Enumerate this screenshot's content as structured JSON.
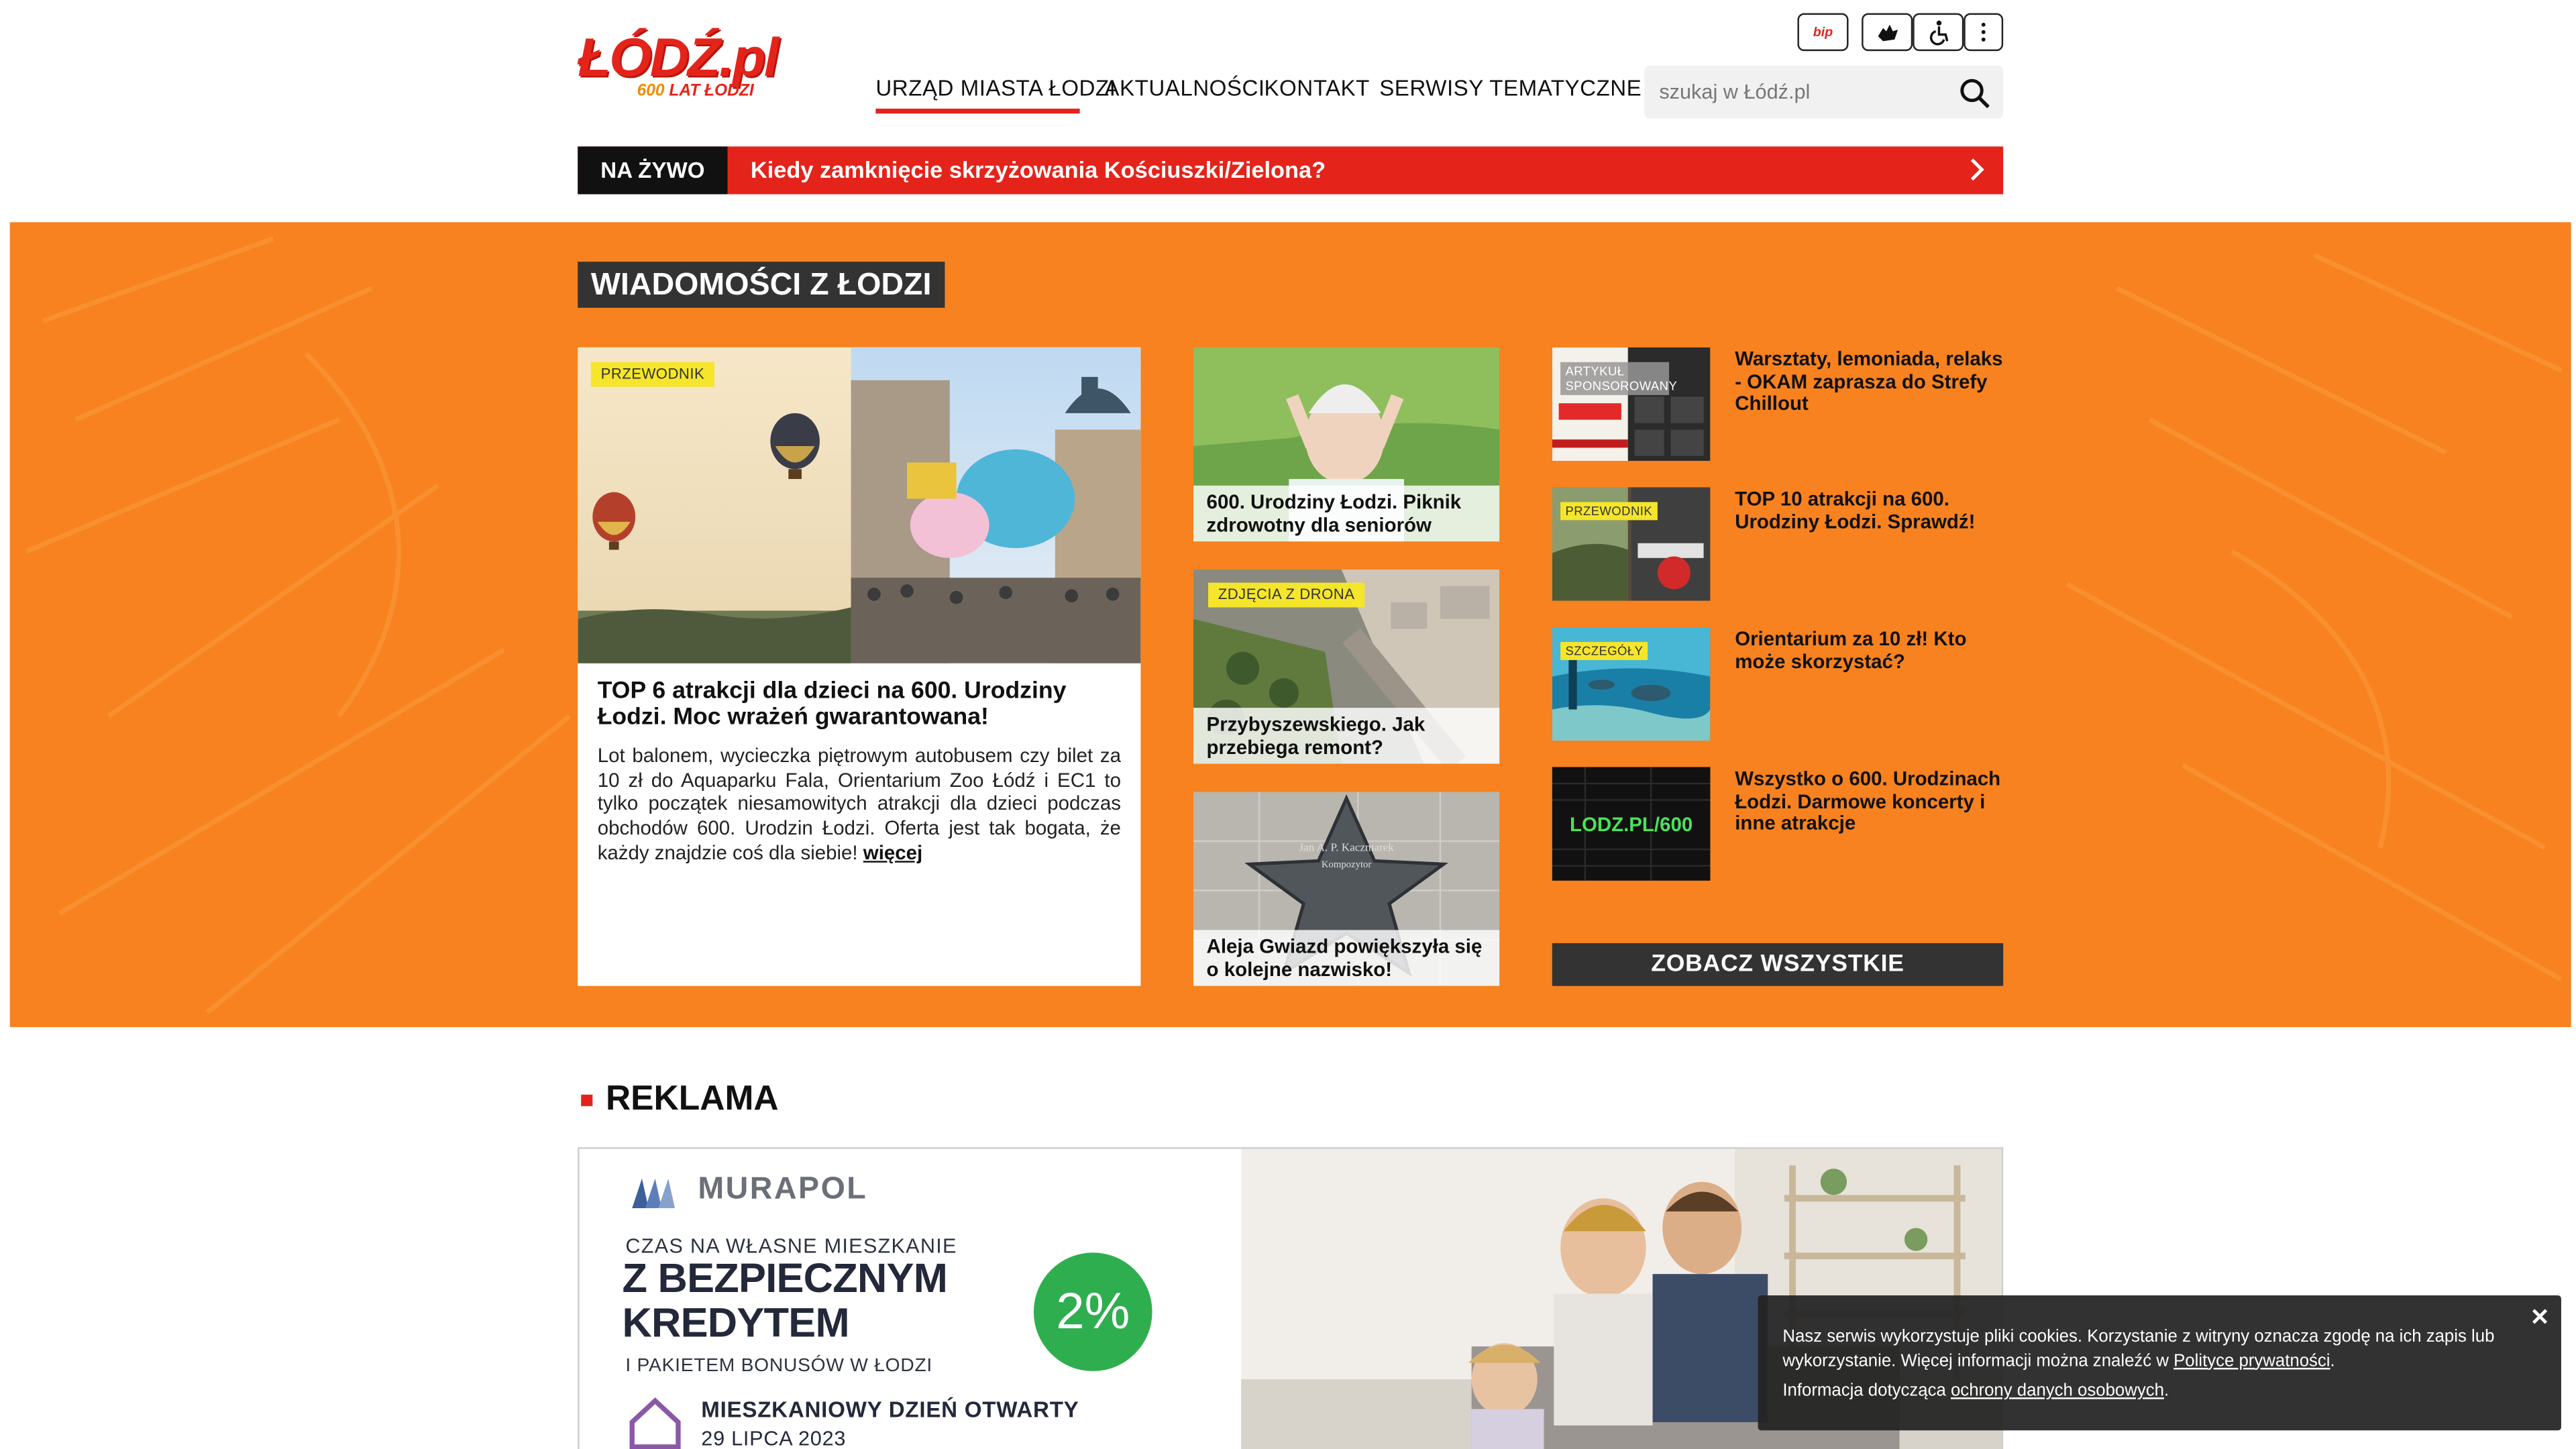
{
  "header": {
    "logo_main": "ŁÓDŹ.pl",
    "logo_sub_number": "600",
    "logo_sub_text": " LAT ŁODZI",
    "util_icons": [
      "bip-icon",
      "sign-language-icon",
      "wheelchair-icon",
      "more-vertical-icon"
    ],
    "bip_label": "bip",
    "nav": [
      {
        "label": "URZĄD MIASTA ŁODZI",
        "active": true
      },
      {
        "label": "AKTUALNOŚCI",
        "active": false
      },
      {
        "label": "KONTAKT",
        "active": false
      },
      {
        "label": "SERWISY TEMATYCZNE",
        "active": false,
        "dropdown": true
      }
    ],
    "search_placeholder": "szukaj w Łódź.pl"
  },
  "live": {
    "label": "NA ŻYWO",
    "text": "Kiedy zamknięcie skrzyżowania Kościuszki/Zielona?"
  },
  "news": {
    "section_title": "WIADOMOŚCI Z ŁODZI",
    "main": {
      "tag": "PRZEWODNIK",
      "title": "TOP 6 atrakcji dla dzieci na 600. Urodziny Łodzi. Moc wrażeń gwarantowana!",
      "lead": "Lot balonem, wycieczka piętrowym autobusem czy bilet za 10 zł do Aquaparku Fala, Orientarium Zoo Łódź i EC1 to tylko początek niesamowitych atrakcji dla dzieci podczas obchodów 600. Urodzin Łodzi. Oferta jest tak bogata, że każdy znajdzie coś dla siebie!",
      "more": "więcej"
    },
    "middle": [
      {
        "title": "600. Urodziny Łodzi. Piknik zdrowotny dla seniorów",
        "tag": ""
      },
      {
        "title": "Przybyszewskiego. Jak przebiega remont?",
        "tag": "ZDJĘCIA Z DRONA"
      },
      {
        "title": "Aleja Gwiazd powiększyła się o kolejne nazwisko!",
        "tag": "",
        "star_name": "Jan A. P. Kaczmarek",
        "star_role": "Kompozytor"
      }
    ],
    "side": [
      {
        "title": "Warsztaty, lemoniada, relaks - OKAM zaprasza do Strefy Chillout",
        "tag": "ARTYKUŁ SPONSOROWANY"
      },
      {
        "title": "TOP 10 atrakcji na 600. Urodziny Łodzi. Sprawdź!",
        "tag": "PRZEWODNIK"
      },
      {
        "title": "Orientarium za 10 zł! Kto może skorzystać?",
        "tag": "SZCZEGÓŁY"
      },
      {
        "title": "Wszystko o 600. Urodzinach Łodzi. Darmowe koncerty i inne atrakcje",
        "tag": "",
        "thumb_text": "LODZ.PL/600"
      }
    ],
    "see_all": "ZOBACZ WSZYSTKIE"
  },
  "ad": {
    "heading": "REKLAMA",
    "brand": "MURAPOL",
    "line1": "CZAS NA WŁASNE MIESZKANIE",
    "line2": "Z BEZPIECZNYM",
    "line3": "KREDYTEM",
    "line4": "I PAKIETEM BONUSÓW W ŁODZI",
    "badge": "2%",
    "line5": "MIESZKANIOWY DZIEŃ OTWARTY",
    "line6": "29 LIPCA 2023"
  },
  "cookie": {
    "text1": "Nasz serwis wykorzystuje pliki cookies. Korzystanie z witryny oznacza zgodę na ich zapis lub wykorzystanie. Więcej informacji można znaleźć w ",
    "link1": "Polityce prywatności",
    "end1": ".",
    "text2": "Informacja dotycząca ",
    "link2": "ochrony danych osobowych",
    "end2": ".",
    "close": "✕"
  },
  "colors": {
    "brand_red": "#e4241b",
    "band_orange": "#f7821f",
    "tag_yellow": "#f5e52b",
    "dark": "#333333"
  }
}
